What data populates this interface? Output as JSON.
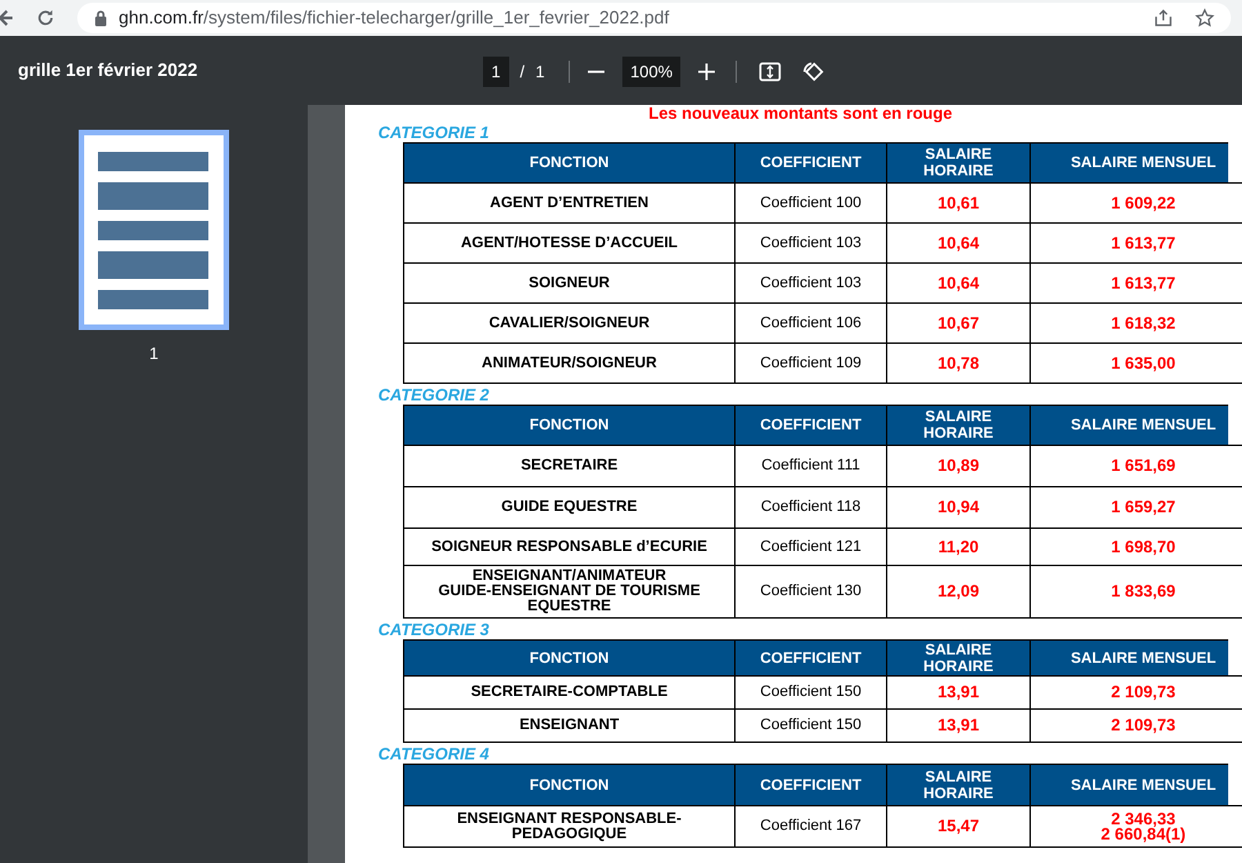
{
  "browser": {
    "url_host": "ghn.com.fr",
    "url_path": "/system/files/fichier-telecharger/grille_1er_fevrier_2022.pdf"
  },
  "viewer": {
    "title": "grille 1er février 2022",
    "page_current": "1",
    "page_separator": "/",
    "page_total": "1",
    "zoom": "100%"
  },
  "sidebar": {
    "thumbnails": [
      {
        "label": "1",
        "selected": true
      }
    ]
  },
  "document": {
    "note": "Les nouveaux montants sont en rouge",
    "categories": [
      {
        "title": "CATEGORIE 1",
        "columns": [
          "FONCTION",
          "COEFFICIENT",
          "SALAIRE HORAIRE",
          "SALAIRE MENSUEL"
        ],
        "rows": [
          {
            "fonction": "AGENT D’ENTRETIEN",
            "coefficient": "Coefficient 100",
            "horaire": "10,61",
            "mensuel": "1 609,22"
          },
          {
            "fonction": "AGENT/HOTESSE D’ACCUEIL",
            "coefficient": "Coefficient 103",
            "horaire": "10,64",
            "mensuel": "1 613,77"
          },
          {
            "fonction": "SOIGNEUR",
            "coefficient": "Coefficient 103",
            "horaire": "10,64",
            "mensuel": "1 613,77"
          },
          {
            "fonction": "CAVALIER/SOIGNEUR",
            "coefficient": "Coefficient 106",
            "horaire": "10,67",
            "mensuel": "1 618,32"
          },
          {
            "fonction": "ANIMATEUR/SOIGNEUR",
            "coefficient": "Coefficient 109",
            "horaire": "10,78",
            "mensuel": "1 635,00"
          }
        ]
      },
      {
        "title": "CATEGORIE 2",
        "columns": [
          "FONCTION",
          "COEFFICIENT",
          "SALAIRE HORAIRE",
          "SALAIRE MENSUEL"
        ],
        "rows": [
          {
            "fonction": "SECRETAIRE",
            "coefficient": "Coefficient 111",
            "horaire": "10,89",
            "mensuel": "1 651,69"
          },
          {
            "fonction": "GUIDE EQUESTRE",
            "coefficient": "Coefficient 118",
            "horaire": "10,94",
            "mensuel": "1 659,27"
          },
          {
            "fonction": "SOIGNEUR RESPONSABLE d’ECURIE",
            "coefficient": "Coefficient 121",
            "horaire": "11,20",
            "mensuel": "1 698,70"
          },
          {
            "fonction": "ENSEIGNANT/ANIMATEUR\nGUIDE-ENSEIGNANT DE TOURISME EQUESTRE",
            "coefficient": "Coefficient 130",
            "horaire": "12,09",
            "mensuel": "1 833,69"
          }
        ]
      },
      {
        "title": "CATEGORIE 3",
        "columns": [
          "FONCTION",
          "COEFFICIENT",
          "SALAIRE HORAIRE",
          "SALAIRE MENSUEL"
        ],
        "rows": [
          {
            "fonction": "SECRETAIRE-COMPTABLE",
            "coefficient": "Coefficient 150",
            "horaire": "13,91",
            "mensuel": "2 109,73"
          },
          {
            "fonction": "ENSEIGNANT",
            "coefficient": "Coefficient 150",
            "horaire": "13,91",
            "mensuel": "2 109,73"
          }
        ]
      },
      {
        "title": "CATEGORIE 4",
        "columns": [
          "FONCTION",
          "COEFFICIENT",
          "SALAIRE HORAIRE",
          "SALAIRE MENSUEL"
        ],
        "rows": [
          {
            "fonction": "ENSEIGNANT RESPONSABLE-\nPEDAGOGIQUE",
            "coefficient": "Coefficient 167",
            "horaire": "15,47",
            "mensuel": "2 346,33\n2 660,84(1)"
          }
        ]
      }
    ]
  }
}
